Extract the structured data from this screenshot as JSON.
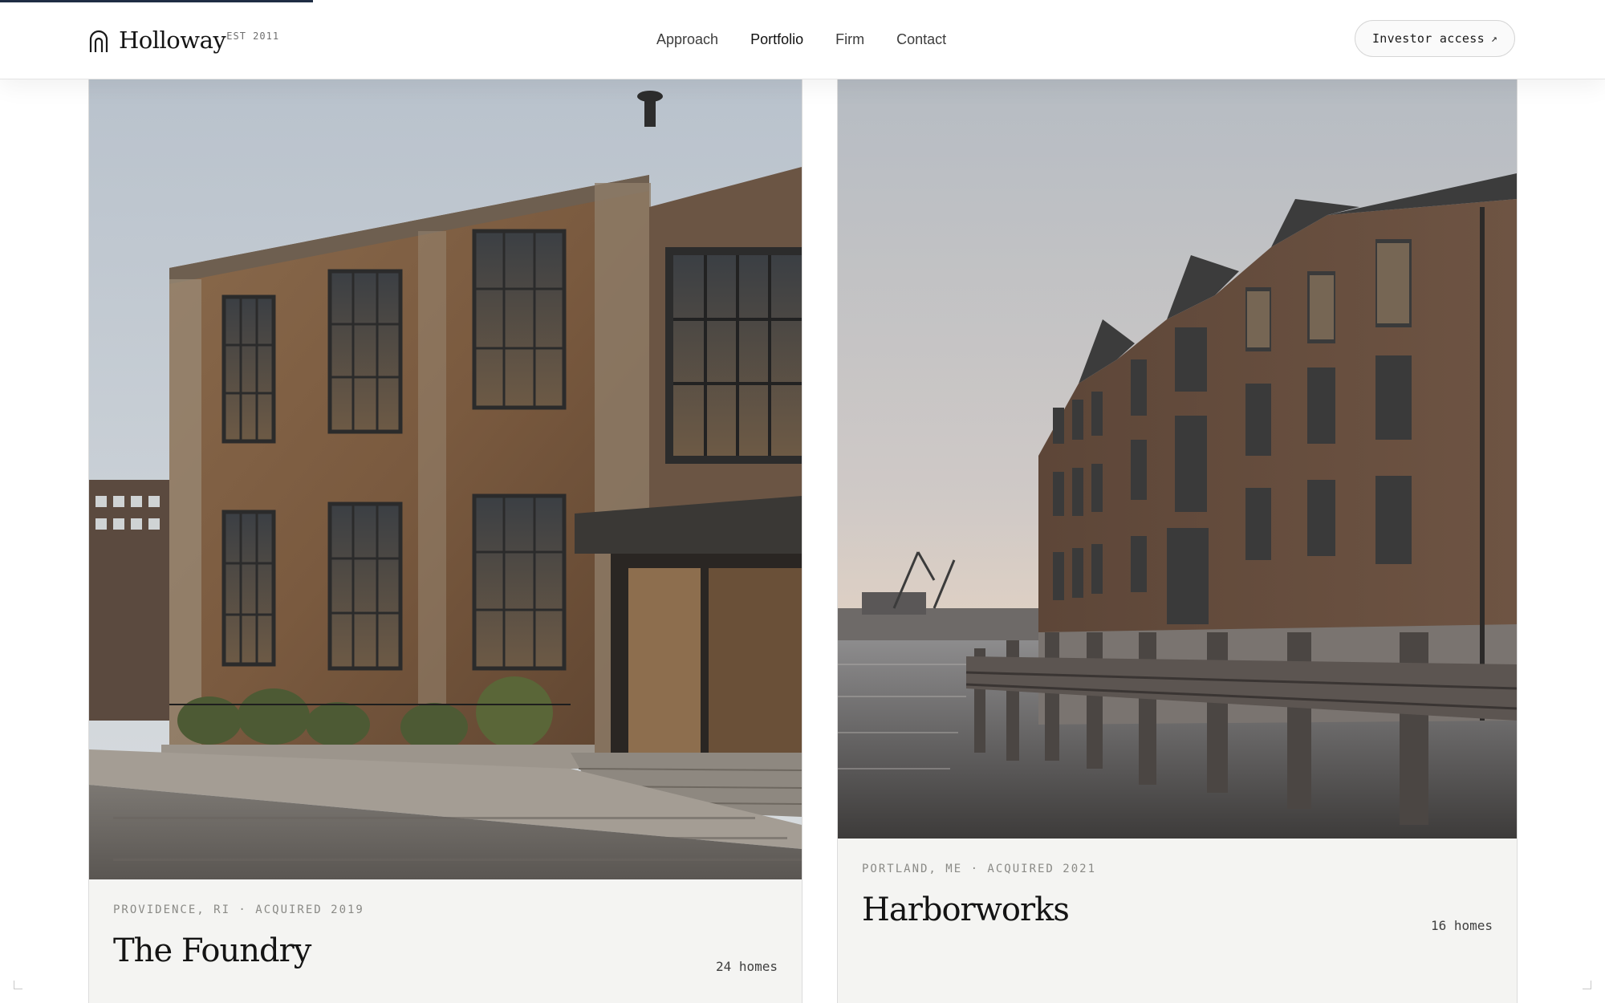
{
  "brand": {
    "name": "Holloway",
    "established": "EST 2011"
  },
  "nav": {
    "items": [
      "Approach",
      "Portfolio",
      "Firm",
      "Contact"
    ],
    "active": "Portfolio"
  },
  "investor_button": {
    "label": "Investor access",
    "arrow": "↗"
  },
  "properties": [
    {
      "meta": "PROVIDENCE, RI · ACQUIRED 2019",
      "name": "The Foundry",
      "homes": "24 homes",
      "image": "brick-industrial-building-photo"
    },
    {
      "meta": "PORTLAND, ME · ACQUIRED 2021",
      "name": "Harborworks",
      "homes": "16 homes",
      "image": "brick-waterfront-warehouse-photo"
    }
  ],
  "colors": {
    "accent": "#1f2d44",
    "card_background": "#f4f4f2"
  }
}
